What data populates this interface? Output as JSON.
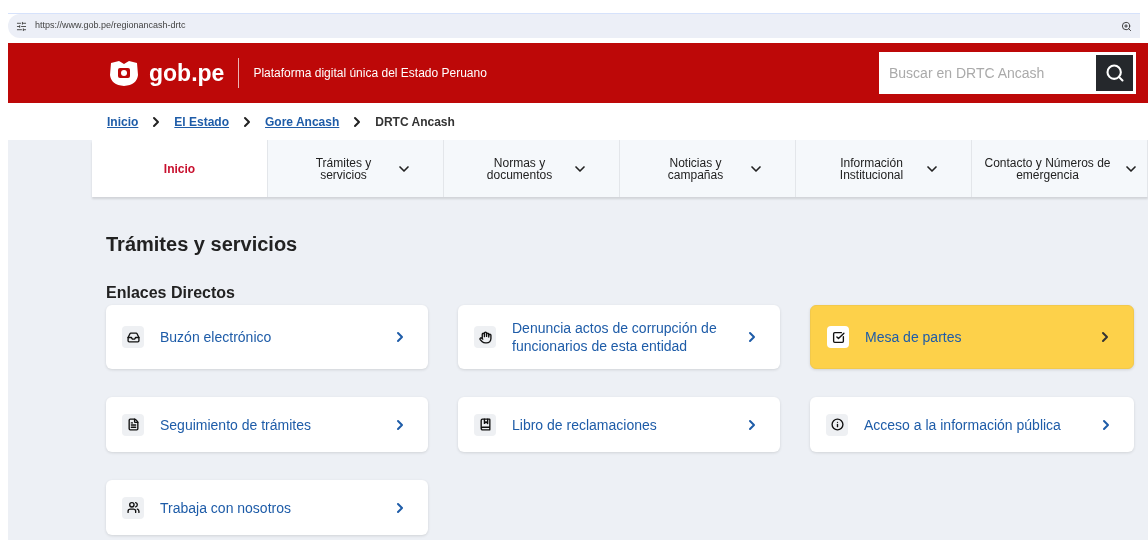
{
  "browser": {
    "url": "https://www.gob.pe/regionancash-drtc"
  },
  "header": {
    "logo_text": "gob.pe",
    "tagline": "Plataforma digital única del Estado Peruano",
    "search": {
      "placeholder": "Buscar en DRTC Ancash"
    }
  },
  "breadcrumb": [
    {
      "label": "Inicio",
      "link": true
    },
    {
      "label": "El Estado",
      "link": true
    },
    {
      "label": "Gore Ancash",
      "link": true
    },
    {
      "label": "DRTC Ancash",
      "link": false
    }
  ],
  "nav": [
    {
      "label": "Inicio",
      "selected": true,
      "dropdown": false
    },
    {
      "label": "Trámites y servicios",
      "selected": false,
      "dropdown": true
    },
    {
      "label": "Normas y documentos",
      "selected": false,
      "dropdown": true
    },
    {
      "label": "Noticias y campañas",
      "selected": false,
      "dropdown": true
    },
    {
      "label": "Información Institucional",
      "selected": false,
      "dropdown": true
    },
    {
      "label": "Contacto y Números de emergencia",
      "selected": false,
      "dropdown": true
    }
  ],
  "section_title": "Trámites y servicios",
  "subsection_title": "Enlaces Directos",
  "links": [
    {
      "label": "Buzón electrónico",
      "highlighted": false
    },
    {
      "label": "Denuncia actos de corrupción de funcionarios de esta entidad",
      "highlighted": false
    },
    {
      "label": "Mesa de partes",
      "highlighted": true
    },
    {
      "label": "Seguimiento de trámites",
      "highlighted": false
    },
    {
      "label": "Libro de reclamaciones",
      "highlighted": false
    },
    {
      "label": "Acceso a la información pública",
      "highlighted": false
    },
    {
      "label": "Trabaja con nosotros",
      "highlighted": false
    }
  ]
}
